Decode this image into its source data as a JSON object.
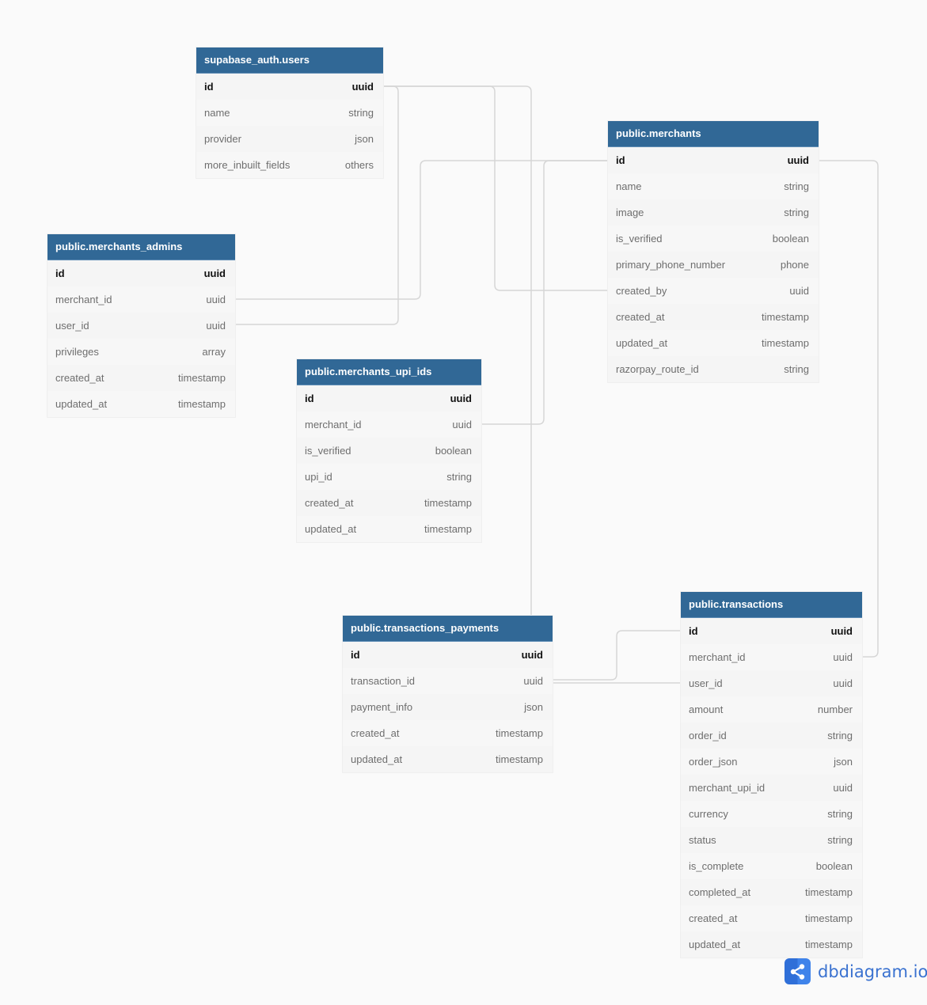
{
  "app": {
    "brand": "dbdiagram.io",
    "brand_icon": "share-nodes-icon"
  },
  "colors": {
    "header": "#316896",
    "connector": "#d6d6d6",
    "background": "#fafafa",
    "brand": "#3a72d0"
  },
  "tables": {
    "users": {
      "name": "supabase_auth.users",
      "fields": [
        {
          "name": "id",
          "type": "uuid"
        },
        {
          "name": "name",
          "type": "string"
        },
        {
          "name": "provider",
          "type": "json"
        },
        {
          "name": "more_inbuilt_fields",
          "type": "others"
        }
      ]
    },
    "merchants": {
      "name": "public.merchants",
      "fields": [
        {
          "name": "id",
          "type": "uuid"
        },
        {
          "name": "name",
          "type": "string"
        },
        {
          "name": "image",
          "type": "string"
        },
        {
          "name": "is_verified",
          "type": "boolean"
        },
        {
          "name": "primary_phone_number",
          "type": "phone"
        },
        {
          "name": "created_by",
          "type": "uuid"
        },
        {
          "name": "created_at",
          "type": "timestamp"
        },
        {
          "name": "updated_at",
          "type": "timestamp"
        },
        {
          "name": "razorpay_route_id",
          "type": "string"
        }
      ]
    },
    "merchants_admins": {
      "name": "public.merchants_admins",
      "fields": [
        {
          "name": "id",
          "type": "uuid"
        },
        {
          "name": "merchant_id",
          "type": "uuid"
        },
        {
          "name": "user_id",
          "type": "uuid"
        },
        {
          "name": "privileges",
          "type": "array"
        },
        {
          "name": "created_at",
          "type": "timestamp"
        },
        {
          "name": "updated_at",
          "type": "timestamp"
        }
      ]
    },
    "merchants_upi_ids": {
      "name": "public.merchants_upi_ids",
      "fields": [
        {
          "name": "id",
          "type": "uuid"
        },
        {
          "name": "merchant_id",
          "type": "uuid"
        },
        {
          "name": "is_verified",
          "type": "boolean"
        },
        {
          "name": "upi_id",
          "type": "string"
        },
        {
          "name": "created_at",
          "type": "timestamp"
        },
        {
          "name": "updated_at",
          "type": "timestamp"
        }
      ]
    },
    "transactions_payments": {
      "name": "public.transactions_payments",
      "fields": [
        {
          "name": "id",
          "type": "uuid"
        },
        {
          "name": "transaction_id",
          "type": "uuid"
        },
        {
          "name": "payment_info",
          "type": "json"
        },
        {
          "name": "created_at",
          "type": "timestamp"
        },
        {
          "name": "updated_at",
          "type": "timestamp"
        }
      ]
    },
    "transactions": {
      "name": "public.transactions",
      "fields": [
        {
          "name": "id",
          "type": "uuid"
        },
        {
          "name": "merchant_id",
          "type": "uuid"
        },
        {
          "name": "user_id",
          "type": "uuid"
        },
        {
          "name": "amount",
          "type": "number"
        },
        {
          "name": "order_id",
          "type": "string"
        },
        {
          "name": "order_json",
          "type": "json"
        },
        {
          "name": "merchant_upi_id",
          "type": "uuid"
        },
        {
          "name": "currency",
          "type": "string"
        },
        {
          "name": "status",
          "type": "string"
        },
        {
          "name": "is_complete",
          "type": "boolean"
        },
        {
          "name": "completed_at",
          "type": "timestamp"
        },
        {
          "name": "created_at",
          "type": "timestamp"
        },
        {
          "name": "updated_at",
          "type": "timestamp"
        }
      ]
    }
  },
  "relationships": [
    {
      "from": "supabase_auth.users.id",
      "to": "public.merchants_admins.user_id"
    },
    {
      "from": "supabase_auth.users.id",
      "to": "public.merchants.created_by"
    },
    {
      "from": "supabase_auth.users.id",
      "to": "public.transactions.user_id"
    },
    {
      "from": "public.merchants.id",
      "to": "public.merchants_admins.merchant_id"
    },
    {
      "from": "public.merchants.id",
      "to": "public.merchants_upi_ids.merchant_id"
    },
    {
      "from": "public.merchants.id",
      "to": "public.transactions.merchant_id"
    },
    {
      "from": "public.transactions.id",
      "to": "public.transactions_payments.transaction_id"
    }
  ]
}
